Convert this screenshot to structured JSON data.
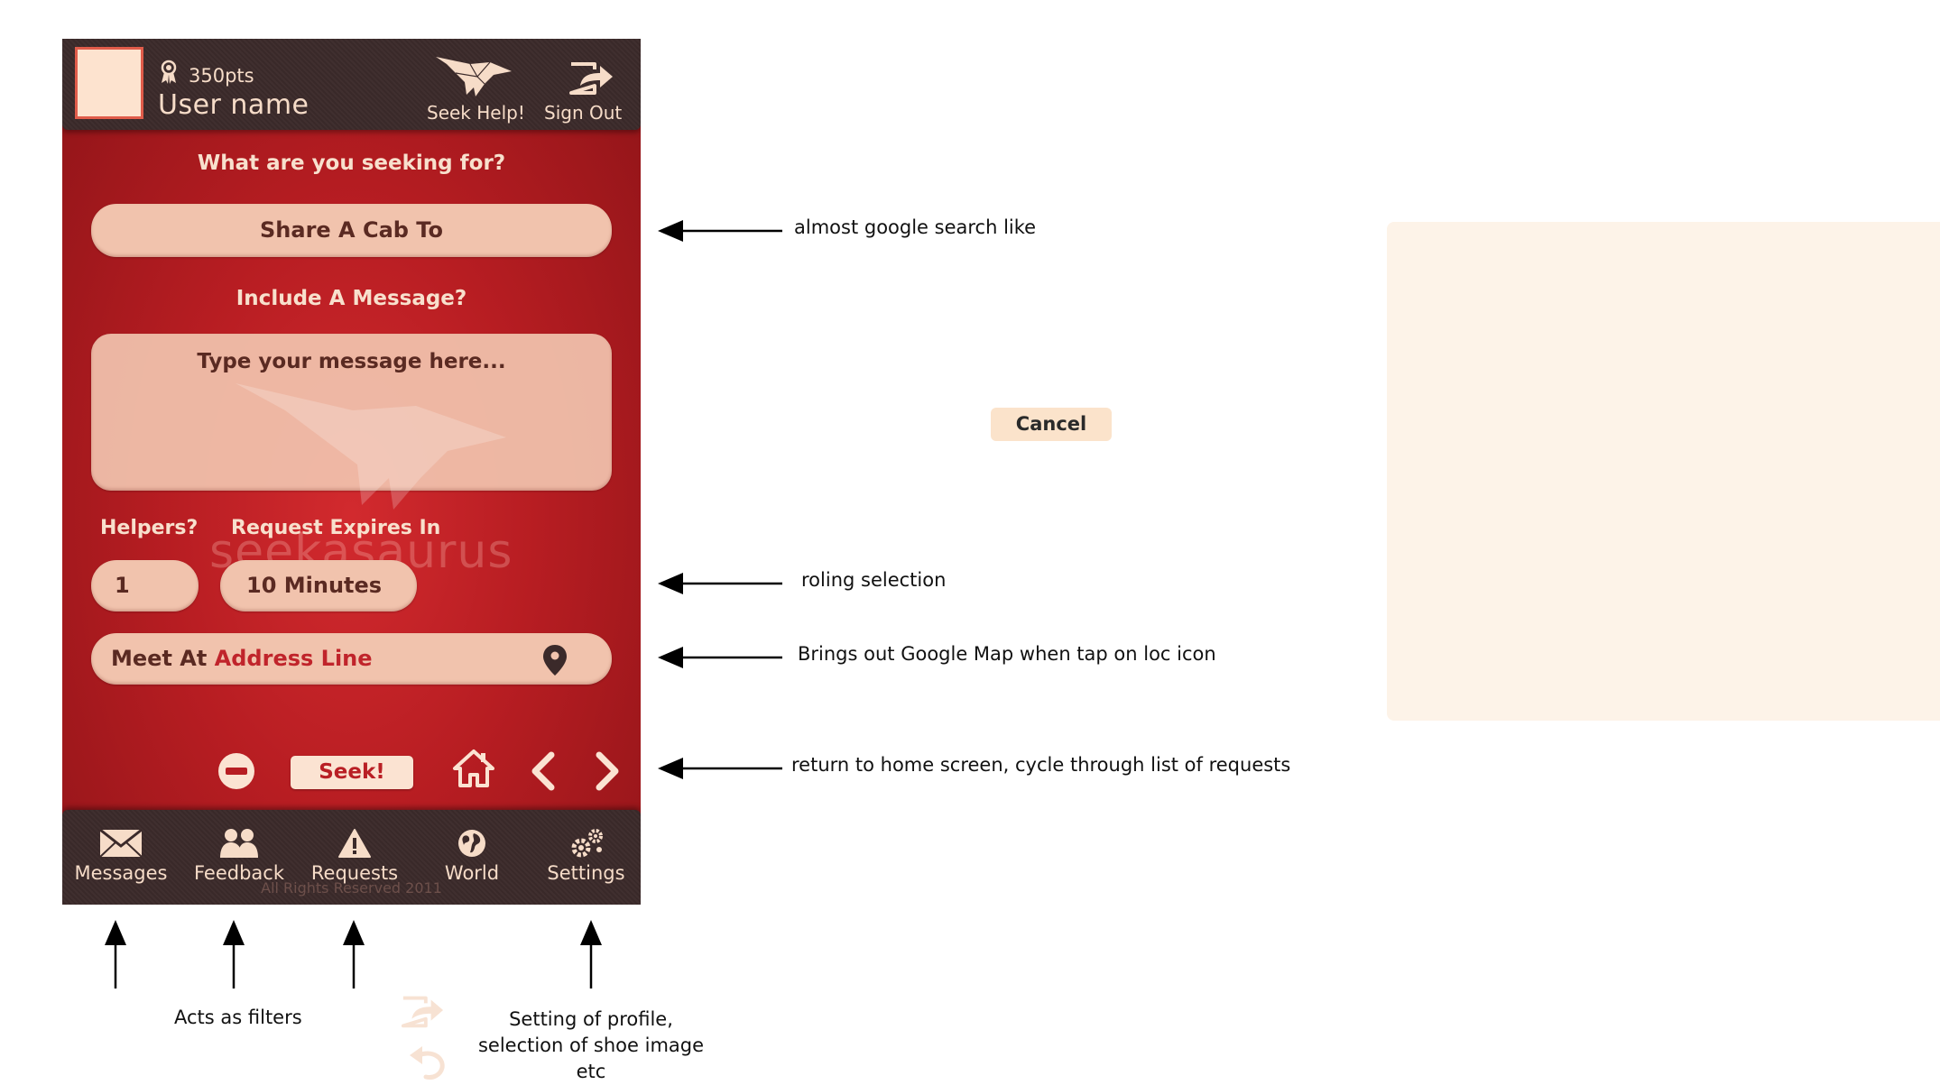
{
  "header": {
    "points": "350pts",
    "username": "User name",
    "seek_help": "Seek Help!",
    "sign_out": "Sign Out"
  },
  "form": {
    "seek_question": "What are you seeking for?",
    "seek_value": "Share A Cab To",
    "message_question": "Include A Message?",
    "message_placeholder": "Type your message here...",
    "helpers_label": "Helpers?",
    "expires_label": "Request Expires In",
    "helpers_value": "1",
    "expires_value": "10 Minutes",
    "meet_prefix": "Meet At",
    "meet_address": "Address Line"
  },
  "watermark": "seekasaurus",
  "actions": {
    "seek": "Seek!"
  },
  "tabs": [
    {
      "label": "Messages",
      "icon": "envelope-icon"
    },
    {
      "label": "Feedback",
      "icon": "people-icon"
    },
    {
      "label": "Requests",
      "icon": "warning-icon"
    },
    {
      "label": "World",
      "icon": "globe-icon"
    },
    {
      "label": "Settings",
      "icon": "gears-icon"
    }
  ],
  "copyright": "All Rights Reserved 2011",
  "annotations": {
    "search": "almost google search like",
    "rolling": "roling selection",
    "map": "Brings out Google Map when tap on loc icon",
    "nav": "return to home screen, cycle through list of requests",
    "filters": "Acts as filters",
    "settings_line1": "Setting of profile,",
    "settings_line2": "selection of shoe image etc"
  },
  "cancel": "Cancel",
  "colors": {
    "phone_red": "#b71d22",
    "bar_dark": "#3b2a2a",
    "pill": "#f1c3ad",
    "cream": "#fbe3d2",
    "accent_red": "#c0242b"
  }
}
